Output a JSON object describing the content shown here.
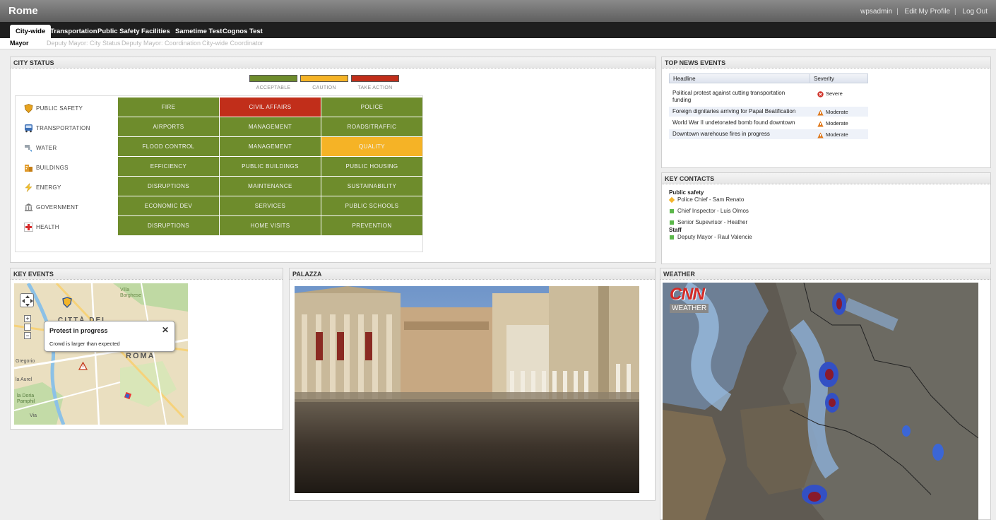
{
  "app": {
    "title": "Rome"
  },
  "user_links": [
    "wpsadmin",
    "Edit My Profile",
    "Log Out"
  ],
  "tabs": [
    "City-wide",
    "Transportation",
    "Public Safety",
    "Facilities",
    "Sametime Test",
    "Cognos Test"
  ],
  "subtabs": [
    "Mayor",
    "Deputy Mayor: City Status",
    "Deputy Mayor: Coordination",
    "City-wide Coordinator"
  ],
  "city_status": {
    "title": "CITY STATUS",
    "legend": [
      {
        "label": "ACCEPTABLE",
        "color": "#6e8c2c"
      },
      {
        "label": "CAUTION",
        "color": "#f5b326"
      },
      {
        "label": "TAKE ACTION",
        "color": "#c12e1a"
      }
    ],
    "rows": [
      {
        "label": "PUBLIC SAFETY",
        "icon": "shield-icon",
        "cells": [
          {
            "label": "FIRE",
            "status": "green"
          },
          {
            "label": "CIVIL AFFAIRS",
            "status": "red"
          },
          {
            "label": "POLICE",
            "status": "green"
          }
        ]
      },
      {
        "label": "TRANSPORTATION",
        "icon": "bus-icon",
        "cells": [
          {
            "label": "AIRPORTS",
            "status": "green"
          },
          {
            "label": "MANAGEMENT",
            "status": "green"
          },
          {
            "label": "ROADS/TRAFFIC",
            "status": "green"
          }
        ]
      },
      {
        "label": "WATER",
        "icon": "water-icon",
        "cells": [
          {
            "label": "FLOOD CONTROL",
            "status": "green"
          },
          {
            "label": "MANAGEMENT",
            "status": "green"
          },
          {
            "label": "QUALITY",
            "status": "yellow"
          }
        ]
      },
      {
        "label": "BUILDINGS",
        "icon": "building-icon",
        "cells": [
          {
            "label": "EFFICIENCY",
            "status": "green"
          },
          {
            "label": "PUBLIC BUILDINGS",
            "status": "green"
          },
          {
            "label": "PUBLIC HOUSING",
            "status": "green"
          }
        ]
      },
      {
        "label": "ENERGY",
        "icon": "lightning-icon",
        "cells": [
          {
            "label": "DISRUPTIONS",
            "status": "green"
          },
          {
            "label": "MAINTENANCE",
            "status": "green"
          },
          {
            "label": "SUSTAINABILITY",
            "status": "green"
          }
        ]
      },
      {
        "label": "GOVERNMENT",
        "icon": "government-icon",
        "cells": [
          {
            "label": "ECONOMIC DEV",
            "status": "green"
          },
          {
            "label": "SERVICES",
            "status": "green"
          },
          {
            "label": "PUBLIC SCHOOLS",
            "status": "green"
          }
        ]
      },
      {
        "label": "HEALTH",
        "icon": "health-cross-icon",
        "cells": [
          {
            "label": "DISRUPTIONS",
            "status": "green"
          },
          {
            "label": "HOME VISITS",
            "status": "green"
          },
          {
            "label": "PREVENTION",
            "status": "green"
          }
        ]
      }
    ]
  },
  "top_news": {
    "title": "TOP NEWS EVENTS",
    "columns": [
      "Headline",
      "Severity"
    ],
    "rows": [
      {
        "headline": "Political protest against cutting transportation funding",
        "severity": "Severe"
      },
      {
        "headline": "Foreign dignitaries arriving for Papal Beatification",
        "severity": "Moderate"
      },
      {
        "headline": "World War II undetonated bomb found downtown",
        "severity": "Moderate"
      },
      {
        "headline": "Downtown warehouse fires in progress",
        "severity": "Moderate"
      }
    ]
  },
  "key_contacts": {
    "title": "KEY CONTACTS",
    "groups": [
      {
        "name": "Public safety",
        "contacts": [
          {
            "name": "Police Chief - Sam Renato",
            "status": "away"
          },
          {
            "name": "Chief Inspector - Luis Olmos",
            "status": "available"
          },
          {
            "name": "Senior Supevrisor - Heather",
            "status": "available"
          }
        ]
      },
      {
        "name": "Staff",
        "contacts": [
          {
            "name": "Deputy Mayor - Raul Valencie",
            "status": "available"
          }
        ]
      }
    ]
  },
  "key_events": {
    "title": "KEY EVENTS",
    "map_labels": [
      "Villa Borghese",
      "CITTÀ DEL",
      "ROMA",
      "Gregorio",
      "la Aurel",
      "la Doria Pamphil",
      "Via"
    ],
    "popup": {
      "title": "Protest in progress",
      "text": "Crowd is larger than expected"
    }
  },
  "palazza": {
    "title": "PALAZZA"
  },
  "weather": {
    "title": "WEATHER",
    "logo_top": "CNN",
    "logo_bottom": "WEATHER"
  }
}
